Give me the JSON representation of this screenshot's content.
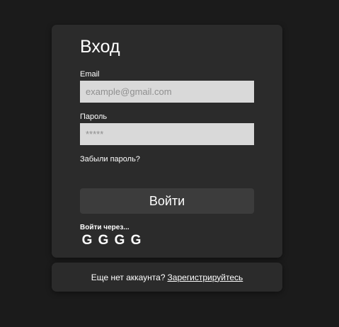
{
  "login": {
    "title": "Вход",
    "email_label": "Email",
    "email_placeholder": "example@gmail.com",
    "password_label": "Пароль",
    "password_placeholder": "*****",
    "forgot_link": "Забыли пароль?",
    "submit_label": "Войти",
    "social_label": "Войти через...",
    "social_buttons": [
      "G",
      "G",
      "G",
      "G"
    ]
  },
  "register": {
    "prompt": "Еще нет аккаунта?",
    "link": "Зарегистрируйтесь"
  },
  "colors": {
    "background": "#1b1b1b",
    "card": "#2b2b2b",
    "input": "#d9d9d9",
    "button": "#3c3c3c"
  }
}
